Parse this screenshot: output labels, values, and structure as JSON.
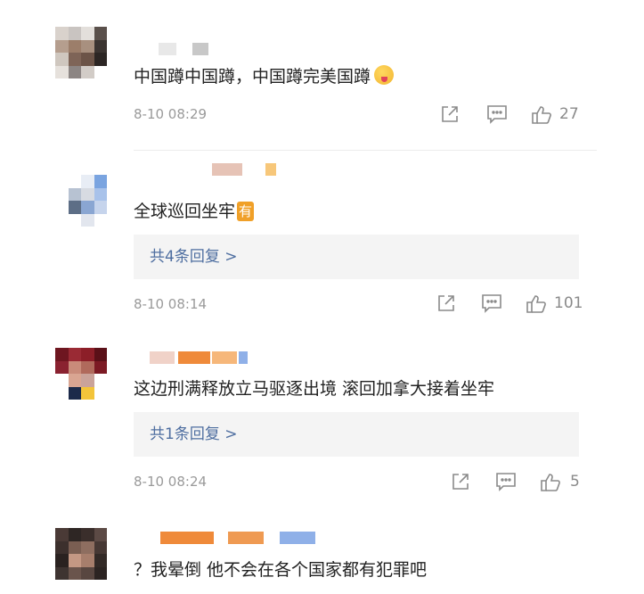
{
  "comments": [
    {
      "text": "中国蹲中国蹲，中国蹲完美国蹲",
      "emoji": "drooling-face-emoji",
      "time": "8-10 08:29",
      "likes": "27"
    },
    {
      "text": "全球巡回坐牢",
      "tag": "有",
      "reply_summary": "共4条回复 >",
      "time": "8-10 08:14",
      "likes": "101"
    },
    {
      "text": "这边刑满释放立马驱逐出境 滚回加拿大接着坐牢",
      "reply_summary": "共1条回复 >",
      "time": "8-10 08:24",
      "likes": "5"
    },
    {
      "text": "？我晕倒 他不会在各个国家都有犯罪吧"
    }
  ],
  "colors": {
    "reply_link": "#4e6ea0",
    "meta_text": "#9a9a9a",
    "reply_bg": "#f4f4f4",
    "tag_orange": "#f0a028"
  },
  "icons": [
    "share-icon",
    "comment-icon",
    "thumbs-up-icon"
  ]
}
